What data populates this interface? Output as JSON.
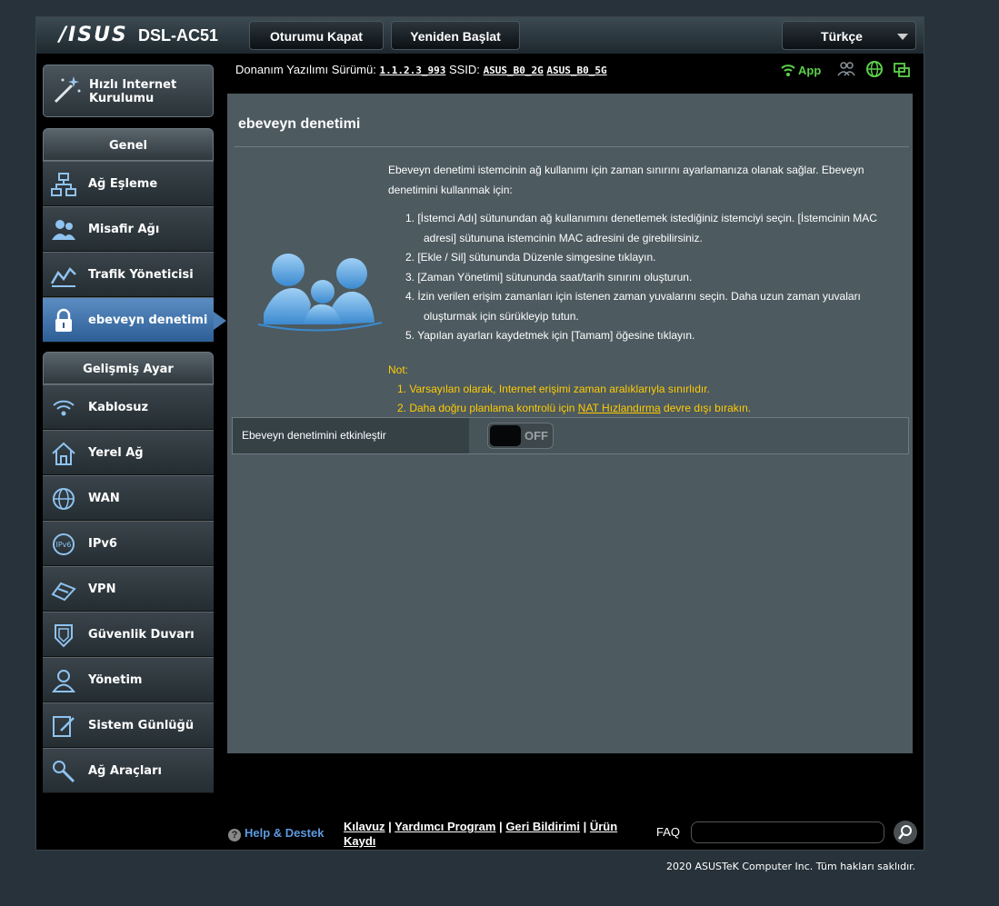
{
  "brand": {
    "logo": "/ISUS",
    "model": "DSL-AC51"
  },
  "topbar": {
    "logout_label": "Oturumu Kapat",
    "reboot_label": "Yeniden Başlat",
    "language": "Türkçe"
  },
  "fwinfo": {
    "fw_label": "Donanım Yazılımı Sürümü:",
    "fw_value": "1.1.2.3_993",
    "ssid_label": "SSID:",
    "ssid_2g": "ASUS_B0_2G",
    "ssid_5g": "ASUS_B0_5G",
    "app_label": "App"
  },
  "sidebar": {
    "qis_label": "Hızlı Internet Kurulumu",
    "general_header": "Genel",
    "general_items": [
      {
        "label": "Ağ Eşleme",
        "icon": "network-map-icon"
      },
      {
        "label": "Misafir Ağı",
        "icon": "guest-network-icon"
      },
      {
        "label": "Trafik Yöneticisi",
        "icon": "traffic-manager-icon"
      },
      {
        "label": "ebeveyn denetimi",
        "icon": "lock-icon",
        "active": true
      }
    ],
    "advanced_header": "Gelişmiş Ayar",
    "advanced_items": [
      {
        "label": "Kablosuz",
        "icon": "wifi-icon"
      },
      {
        "label": "Yerel Ağ",
        "icon": "home-icon"
      },
      {
        "label": "WAN",
        "icon": "globe-icon"
      },
      {
        "label": "IPv6",
        "icon": "ipv6-icon"
      },
      {
        "label": "VPN",
        "icon": "vpn-icon"
      },
      {
        "label": "Güvenlik Duvarı",
        "icon": "shield-icon"
      },
      {
        "label": "Yönetim",
        "icon": "admin-icon"
      },
      {
        "label": "Sistem Günlüğü",
        "icon": "log-icon"
      },
      {
        "label": "Ağ Araçları",
        "icon": "tools-icon"
      }
    ]
  },
  "main": {
    "title": "ebeveyn denetimi",
    "description": "Ebeveyn denetimi istemcinin ağ kullanımı için zaman sınırını ayarlamanıza olanak sağlar. Ebeveyn denetimini kullanmak için:",
    "steps": [
      "1. [İstemci Adı] sütunundan ağ kullanımını denetlemek istediğiniz istemciyi seçin. [İstemcinin MAC adresi] sütununa istemcinin MAC adresini de girebilirsiniz.",
      "2. [Ekle / Sil] sütununda Düzenle simgesine tıklayın.",
      "3. [Zaman Yönetimi] sütununda saat/tarih sınırını oluşturun.",
      "4. İzin verilen erişim zamanları için istenen zaman yuvalarını seçin. Daha uzun zaman yuvaları oluşturmak için sürükleyip tutun.",
      "5. Yapılan ayarları kaydetmek için [Tamam] öğesine tıklayın."
    ],
    "note_label": "Not:",
    "note1": "1. Varsayılan olarak, Internet erişimi zaman aralıklarıyla sınırlıdır.",
    "note2_pre": "2. Daha doğru planlama kontrolü için ",
    "note2_link": "NAT Hızlandırma",
    "note2_post": " devre dışı bırakın.",
    "enable_label": "Ebeveyn denetimini etkinleştir",
    "toggle_state": "OFF"
  },
  "footer": {
    "help_label": "Help & Destek",
    "link1": "Kılavuz",
    "link2": "Yardımcı Program",
    "link3": "Geri Bildirimi",
    "link4": "Ürün Kaydı",
    "faq_label": "FAQ",
    "faq_placeholder": "",
    "copyright": "2020 ASUSTeK Computer Inc. Tüm hakları saklıdır."
  },
  "colors": {
    "accent": "#4b7cb3",
    "note": "#ffcc00",
    "app": "#5bd14a"
  }
}
